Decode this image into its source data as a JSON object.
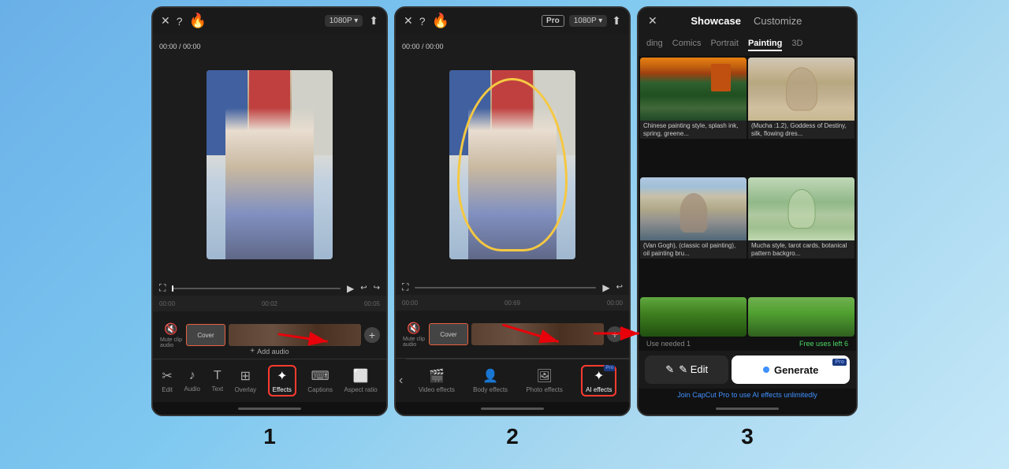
{
  "background": {
    "gradient": "linear-gradient(135deg, #6ab0e8 0%, #7ec8f0 40%, #a8d8f0 70%, #c5e8f8 100%)"
  },
  "steps": [
    {
      "number": "1",
      "phone": {
        "resolution": "1080P ▾",
        "time_display": "00:00 / 00:00",
        "timeline_times": [
          "00:00",
          "00:02",
          "00:05"
        ],
        "toolbar_items": [
          {
            "icon": "✂",
            "label": "Edit"
          },
          {
            "icon": "♪",
            "label": "Audio"
          },
          {
            "icon": "T",
            "label": "Text"
          },
          {
            "icon": "⊞",
            "label": "Overlay"
          },
          {
            "icon": "✦",
            "label": "Effects",
            "highlighted": true
          },
          {
            "icon": "⌨",
            "label": "Captions"
          },
          {
            "icon": "⬜",
            "label": "Aspect ratio"
          }
        ],
        "arrow_text": "Effects button"
      }
    },
    {
      "number": "2",
      "phone": {
        "resolution": "1080P ▾",
        "time_display": "00:00 / 00:00",
        "toolbar_items": [
          {
            "icon": "🎬",
            "label": "Video effects"
          },
          {
            "icon": "👤",
            "label": "Body effects"
          },
          {
            "icon": "🖼",
            "label": "Photo effects"
          },
          {
            "icon": "✦",
            "label": "AI effects",
            "highlighted": true,
            "pro": true
          }
        ],
        "arrow_text": "AI effects button"
      }
    },
    {
      "number": "3",
      "panel": {
        "title": "Showcase",
        "customize_tab": "Customize",
        "category_tabs": [
          "ding",
          "Comics",
          "Portrait",
          "Painting",
          "3D"
        ],
        "active_tab": "Painting",
        "gallery_items": [
          {
            "style": "chinese",
            "caption": "Chinese painting style, splash ink, spring, greene..."
          },
          {
            "style": "mucha",
            "caption": "(Mucha :1.2), Goddess of Destiny, silk, flowing dres..."
          },
          {
            "style": "vangogh",
            "caption": "(Van Gogh), (classic oil painting), oil painting bru..."
          },
          {
            "style": "mucha2",
            "caption": "Mucha style, tarot cards, botanical pattern backgro..."
          }
        ],
        "use_info": "Use needed 1",
        "free_uses": "Free uses left 6",
        "edit_label": "✎ Edit",
        "generate_label": "Generate",
        "generate_dot_color": "#4090ff",
        "pro_label": "Pro",
        "join_text": "Join CapCut Pro to use AI effects unlimitedly"
      }
    }
  ]
}
